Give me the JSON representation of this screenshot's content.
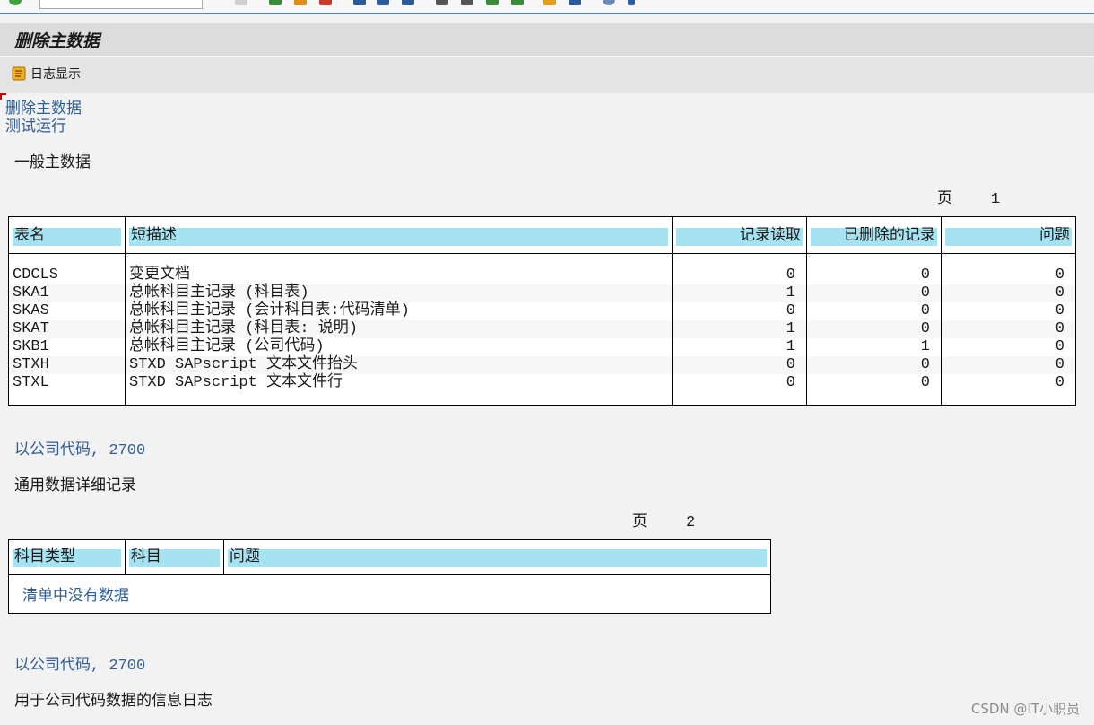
{
  "title": "删除主数据",
  "app_toolbar": {
    "log_display_label": "日志显示"
  },
  "header_lines": {
    "line1": "删除主数据",
    "line2": "测试运行"
  },
  "section1": {
    "heading": "一般主数据",
    "page_label": "页",
    "page_number": "1",
    "columns": [
      "表名",
      "短描述",
      "记录读取",
      "已删除的记录",
      "问题"
    ],
    "rows": [
      {
        "table": "CDCLS",
        "desc": "变更文档",
        "read": "0",
        "deleted": "0",
        "issues": "0"
      },
      {
        "table": "SKA1",
        "desc": "总帐科目主记录 (科目表)",
        "read": "1",
        "deleted": "0",
        "issues": "0"
      },
      {
        "table": "SKAS",
        "desc": "总帐科目主记录 (会计科目表:代码清单)",
        "read": "0",
        "deleted": "0",
        "issues": "0"
      },
      {
        "table": "SKAT",
        "desc": "总帐科目主记录 (科目表: 说明)",
        "read": "1",
        "deleted": "0",
        "issues": "0"
      },
      {
        "table": "SKB1",
        "desc": "总帐科目主记录 (公司代码)",
        "read": "1",
        "deleted": "1",
        "issues": "0"
      },
      {
        "table": "STXH",
        "desc": "STXD SAPscript 文本文件抬头",
        "read": "0",
        "deleted": "0",
        "issues": "0"
      },
      {
        "table": "STXL",
        "desc": "STXD SAPscript 文本文件行",
        "read": "0",
        "deleted": "0",
        "issues": "0"
      }
    ]
  },
  "section2": {
    "company_line": "以公司代码, 2700",
    "heading": "通用数据详细记录",
    "page_label": "页",
    "page_number": "2",
    "columns": [
      "科目类型",
      "科目",
      "问题"
    ],
    "empty_message": "清单中没有数据"
  },
  "section3": {
    "company_line": "以公司代码, 2700",
    "heading": "用于公司代码数据的信息日志"
  },
  "watermark": "CSDN @IT小职员",
  "colors": {
    "header_bar": "#a6e3f2",
    "link_blue": "#2f5f97",
    "toolbar_accent": "#4a86c5"
  }
}
